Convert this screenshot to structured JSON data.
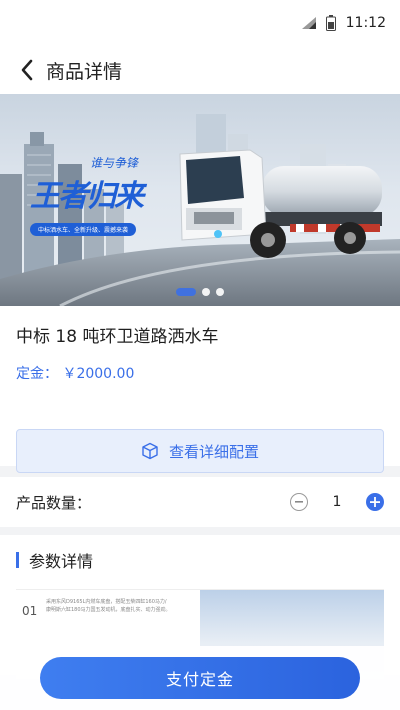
{
  "status_bar": {
    "time": "11:12"
  },
  "header": {
    "title": "商品详情"
  },
  "banner": {
    "slogan_line1": "谁与争锋",
    "slogan_line2": "王者归来",
    "tagline": "中标洒水车、全新升级、震撼来袭",
    "dots_count": 3,
    "active_dot": 0
  },
  "product": {
    "name": "中标 18 吨环卫道路洒水车",
    "price_label": "定金：",
    "price_value": "￥2000.00"
  },
  "config_button": {
    "label": "查看详细配置"
  },
  "quantity": {
    "label": "产品数量：",
    "value": "1"
  },
  "params": {
    "title": "参数详情",
    "index": "01",
    "desc": [
      "采用东风D9165L内燃车底盘，搭配玉柴四缸160马力/",
      "康明斯六缸180马力国五发动机，底盘扎实、动力强劲。"
    ]
  },
  "bottom": {
    "pay_label": "支付定金"
  },
  "colors": {
    "accent": "#3a6fe8",
    "config_bg": "#e8effc"
  }
}
